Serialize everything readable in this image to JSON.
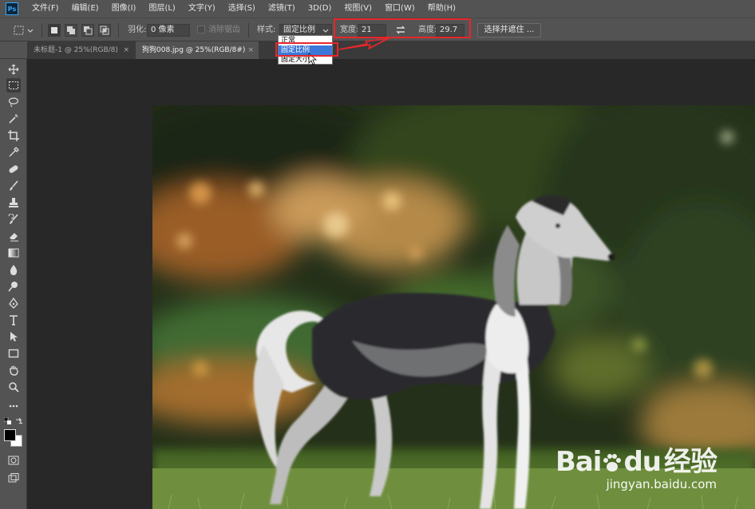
{
  "app": {
    "logo_text": "Ps"
  },
  "menu": [
    "文件(F)",
    "编辑(E)",
    "图像(I)",
    "图层(L)",
    "文字(Y)",
    "选择(S)",
    "滤镜(T)",
    "3D(D)",
    "视图(V)",
    "窗口(W)",
    "帮助(H)"
  ],
  "options": {
    "feather_label": "羽化:",
    "feather_value": "0 像素",
    "antialias_label": "消除锯齿",
    "style_label": "样式:",
    "style_value": "固定比例",
    "width_label": "宽度:",
    "width_value": "21",
    "swap_icon": "swap-arrows-icon",
    "height_label": "高度:",
    "height_value": "29.7",
    "select_subject": "选择并遮住 ..."
  },
  "style_dropdown": {
    "options": [
      "正常",
      "固定比例",
      "固定大小"
    ],
    "selected_index": 1
  },
  "tabs": [
    {
      "label": "未标题-1 @ 25%(RGB/8)",
      "close": "×"
    },
    {
      "label": "狗狗008.jpg @ 25%(RGB/8#)",
      "close": "×",
      "active": true
    }
  ],
  "tools": [
    "move-icon",
    "marquee-icon",
    "lasso-icon",
    "magic-wand-icon",
    "crop-icon",
    "eyedropper-icon",
    "healing-icon",
    "brush-icon",
    "stamp-icon",
    "history-brush-icon",
    "eraser-icon",
    "gradient-icon",
    "blur-icon",
    "dodge-icon",
    "pen-icon",
    "type-icon",
    "path-select-icon",
    "rectangle-icon",
    "hand-icon",
    "zoom-icon",
    "more-icon"
  ],
  "watermark": {
    "brand": "Bai",
    "brand_cn": "经验",
    "brand_suffix": "du",
    "url": "jingyan.baidu.com"
  },
  "colors": {
    "annotation_red": "#e8262a",
    "selected_blue": "#3c78d8"
  }
}
